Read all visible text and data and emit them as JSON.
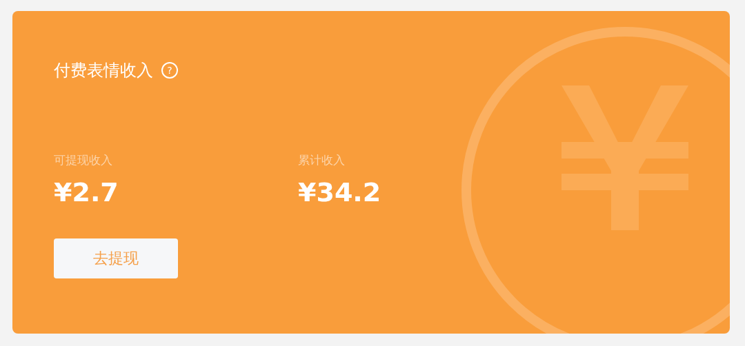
{
  "card": {
    "title": "付费表情收入",
    "help_icon": "?"
  },
  "stats": [
    {
      "label": "可提现收入",
      "value": "¥2.7"
    },
    {
      "label": "累计收入",
      "value": "¥34.2"
    }
  ],
  "button": {
    "label": "去提现"
  }
}
